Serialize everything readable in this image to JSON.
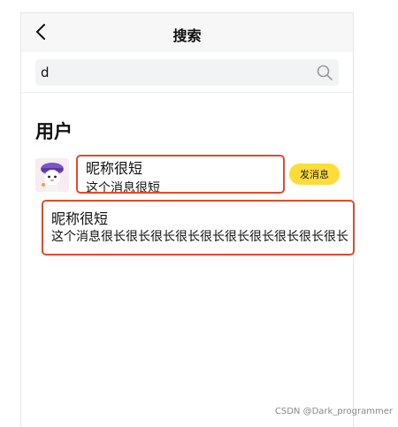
{
  "navbar": {
    "title": "搜索",
    "back_icon": "chevron-left-icon"
  },
  "search": {
    "value": "d",
    "icon": "search-icon"
  },
  "section": {
    "title": "用户"
  },
  "user": {
    "nickname": "昵称很短",
    "message": "这个消息很短",
    "action_label": "发消息",
    "avatar": "avatar-icon"
  },
  "long_item": {
    "nickname": "昵称很短",
    "message": "这个消息很长很长很长很长很长很长很长很长很长很长"
  },
  "watermark": "CSDN @Dark_programmer",
  "colors": {
    "accent": "#ffdc3a",
    "highlight": "#e04b2e",
    "navbar_bg": "#f7f7f7",
    "search_bg": "#f2f3f5"
  }
}
